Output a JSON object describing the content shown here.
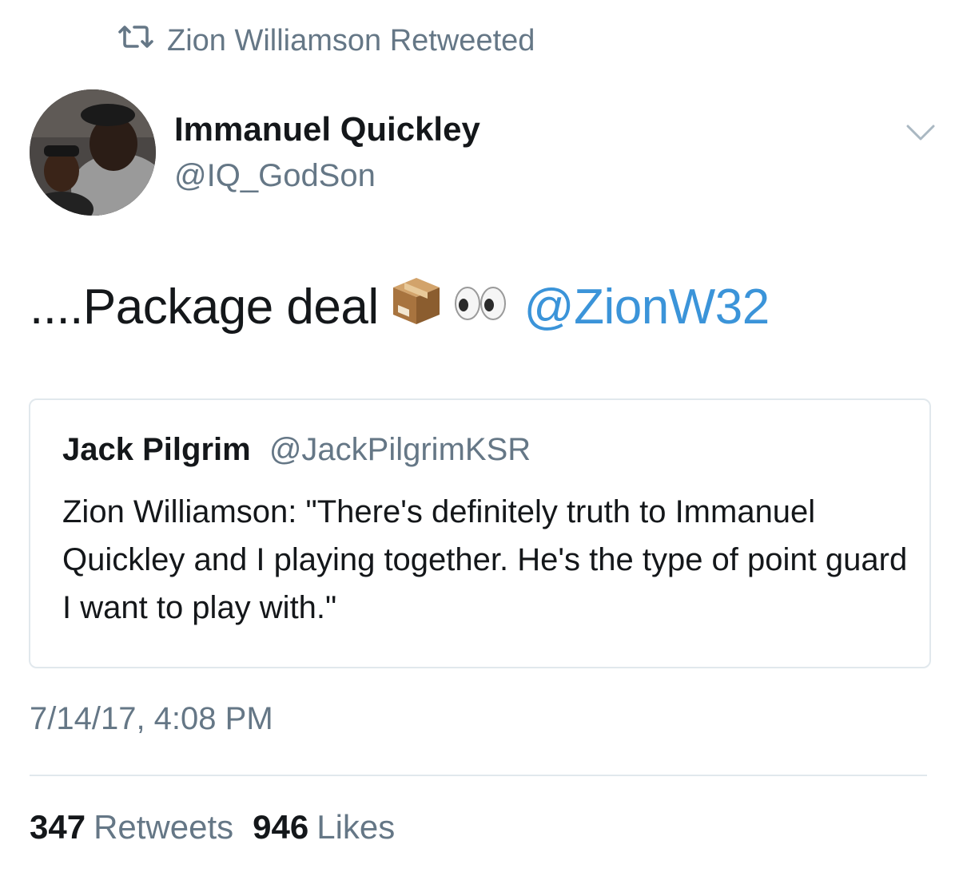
{
  "retweet_context": {
    "text": "Zion Williamson Retweeted",
    "icon": "retweet-icon"
  },
  "author": {
    "name": "Immanuel Quickley",
    "handle": "@IQ_GodSon"
  },
  "tweet": {
    "text": "....Package deal",
    "emoji": [
      "package-emoji",
      "eyes-emoji"
    ],
    "mention": "@ZionW32"
  },
  "quoted_tweet": {
    "name": "Jack Pilgrim",
    "handle": "@JackPilgrimKSR",
    "text": "Zion Williamson: \"There's definitely truth to Immanuel Quickley and I playing together. He's the type of point guard I want to play with.\""
  },
  "timestamp": "7/14/17, 4:08 PM",
  "stats": {
    "retweets_count": "347",
    "retweets_label": "Retweets",
    "likes_count": "946",
    "likes_label": "Likes"
  },
  "colors": {
    "link": "#3b94d9",
    "secondary_text": "#657786",
    "border": "#e1e8ed"
  }
}
